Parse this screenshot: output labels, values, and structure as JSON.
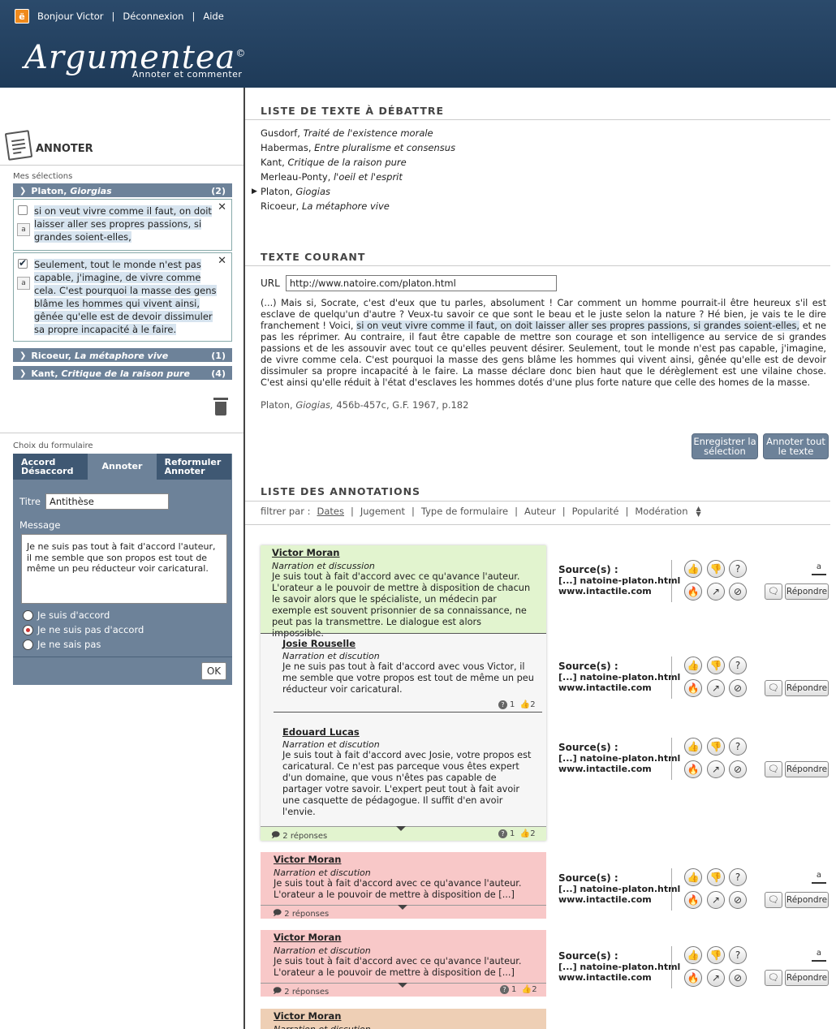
{
  "topbar": {
    "greeting": "Bonjour Victor",
    "logout": "Déconnexion",
    "help": "Aide",
    "logo_glyph": "ë"
  },
  "brand": {
    "name": "Argumentea",
    "reg": "©",
    "tagline": "Annoter et commenter"
  },
  "sidebar": {
    "title": "ANNOTER",
    "selections_label": "Mes sélections",
    "groups": [
      {
        "author": "Platon,",
        "work": "Giorgias",
        "count": "(2)"
      },
      {
        "author": "Ricoeur,",
        "work": "La métaphore vive",
        "count": "(1)"
      },
      {
        "author": "Kant,",
        "work": "Critique de la raison pure",
        "count": "(4)"
      }
    ],
    "selections": [
      {
        "text": "si on veut vivre comme il faut, on doit laisser aller ses propres passions, si grandes soient-elles,",
        "checked": false
      },
      {
        "text": "Seulement, tout le monde n'est pas capable, j'imagine, de vivre comme cela. C'est pourquoi la masse des gens blâme les hommes qui vivent ainsi, gênée qu'elle est de devoir dissimuler sa propre incapacité à le faire.",
        "checked": true
      }
    ],
    "form_label": "Choix du formulaire",
    "tabs": [
      "Accord Désaccord",
      "Annoter",
      "Reformuler Annoter"
    ],
    "active_tab": "Annoter",
    "titre_label": "Titre",
    "titre_value": "Antithèse",
    "message_label": "Message",
    "message_value": "Je ne suis pas tout à fait d'accord l'auteur, il me semble que son propos est tout de même un peu réducteur voir caricatural.",
    "radios": [
      {
        "label": "Je suis d'accord",
        "checked": false
      },
      {
        "label": "Je ne suis pas d'accord",
        "checked": true
      },
      {
        "label": "Je ne sais pas",
        "checked": false
      }
    ],
    "ok": "OK"
  },
  "texts": {
    "title": "LISTE DE TEXTE À DÉBATTRE",
    "items": [
      {
        "author": "Gusdorf,",
        "work": "Traité de l'existence morale"
      },
      {
        "author": "Habermas,",
        "work": "Entre pluralisme et consensus"
      },
      {
        "author": "Kant,",
        "work": "Critique de la raison pure"
      },
      {
        "author": "Merleau-Ponty,",
        "work": "l'oeil et l'esprit"
      },
      {
        "author": "Platon,",
        "work": "Giogias",
        "current": true
      },
      {
        "author": "Ricoeur,",
        "work": "La métaphore vive"
      }
    ]
  },
  "current": {
    "title": "TEXTE COURANT",
    "url_label": "URL",
    "url_value": "http://www.natoire.com/platon.html",
    "text_before": "(...) Mais si, Socrate, c'est d'eux que tu parles, absolument ! Car comment un homme pourrait-il être heureux s'il est esclave de quelqu'un d'autre ? Veux-tu savoir ce que sont le beau et le juste selon la nature ? Hé bien, je vais te le dire franchement ! Voici,",
    "text_highlight": "si on veut vivre comme il faut, on doit laisser aller ses propres passions, si grandes soient-elles,",
    "text_after": "et ne pas les réprimer. Au contraire, il faut être capable de mettre son courage et son intelligence au service de si grandes passions et de les assouvir avec tout ce qu'elles peuvent désirer. Seulement, tout le monde n'est pas capable, j'imagine, de vivre comme cela. C'est pourquoi la masse des gens blâme les hommes qui vivent ainsi, gênée qu'elle est de devoir dissimuler sa propre incapacité à le faire. La masse déclare donc bien haut que le dérèglement est une vilaine chose. C'est ainsi qu'elle réduit à l'état d'esclaves les hommes dotés d'une plus forte nature que celle des homes de la masse.",
    "citation_author": "Platon,",
    "citation_work": "Giogias,",
    "citation_rest": "456b-457c, G.F. 1967, p.182",
    "btn_save": "Enregistrer la sélection",
    "btn_annotate": "Annoter tout le texte"
  },
  "annotations": {
    "title": "LISTE DES ANNOTATIONS",
    "filter_label": "filtrer par :",
    "filters": [
      "Dates",
      "Jugement",
      "Type de formulaire",
      "Auteur",
      "Popularité",
      "Modération"
    ],
    "source_label": "Source(s) :",
    "source_1": "[...] natoine-platon.html",
    "source_2": "www.intactile.com",
    "reply": "Répondre",
    "replies_count": "2 réponses",
    "q_count": "1",
    "like_count": "2",
    "colors": {
      "green": "#e2f4cf",
      "grey": "#f6f6f6",
      "red": "#f8c8c8",
      "orange": "#eecfb5"
    },
    "items": [
      {
        "author": "Victor Moran",
        "type": "Narration et discussion",
        "msg": "Je suis tout à fait d'accord avec ce qu'avance l'auteur. L'orateur a le pouvoir de mettre à disposition de chacun le savoir alors que le spécialiste, un médecin par exemple est souvent prisonnier de sa connaissance, ne peut pas la transmettre. Le dialogue est alors impossible."
      },
      {
        "author": "Josie Rouselle",
        "type": "Narration et discution",
        "msg": "Je ne suis pas tout à fait d'accord avec vous Victor, il me semble que votre propos est tout de même un peu réducteur voir caricatural."
      },
      {
        "author": "Edouard Lucas",
        "type": "Narration et discution",
        "msg": "Je suis tout à fait d'accord avec Josie, votre propos est caricatural. Ce n'est pas parceque vous êtes expert d'un domaine, que vous n'êtes pas capable de partager votre savoir. L'expert peut tout à fait avoir une casquette de pédagogue. Il suffit d'en avoir l'envie."
      },
      {
        "author": "Victor Moran",
        "type": "Narration et discution",
        "msg": "Je suis tout à fait d'accord avec ce qu'avance l'auteur. L'orateur a le pouvoir de mettre à disposition de [...]"
      },
      {
        "author": "Victor Moran",
        "type": "Narration et discution",
        "msg": "Je suis tout à fait d'accord avec ce qu'avance l'auteur. L'orateur a le pouvoir de mettre à disposition de [...]"
      },
      {
        "author": "Victor Moran",
        "type": "Narration et discution",
        "msg": ""
      }
    ]
  }
}
